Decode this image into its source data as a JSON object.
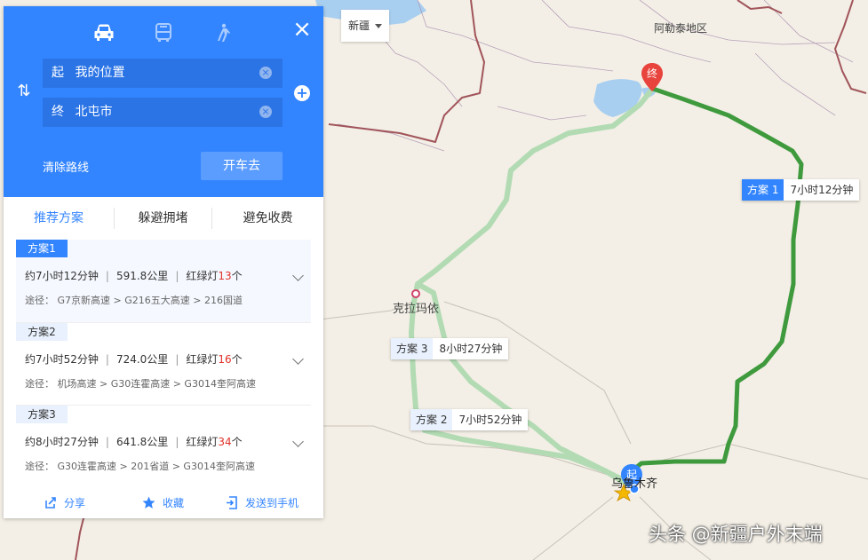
{
  "panel": {
    "modes": [
      "drive-icon",
      "bus-icon",
      "walk-icon"
    ],
    "origin": {
      "prefix": "起",
      "value": "我的位置"
    },
    "destination": {
      "prefix": "终",
      "value": "北屯市"
    },
    "clear_label": "清除路线",
    "go_label": "开车去",
    "tabs": [
      "推荐方案",
      "躲避拥堵",
      "避免收费"
    ],
    "plans": [
      {
        "tag": "方案1",
        "time": "约7小时12分钟",
        "distance": "591.8公里",
        "lights_label": "红绿灯",
        "lights": "13",
        "lights_unit": "个",
        "route": "途径： G7京新高速 > G216五大高速 > 216国道"
      },
      {
        "tag": "方案2",
        "time": "约7小时52分钟",
        "distance": "724.0公里",
        "lights_label": "红绿灯",
        "lights": "16",
        "lights_unit": "个",
        "route": "途径： 机场高速 > G30连霍高速 > G3014奎阿高速"
      },
      {
        "tag": "方案3",
        "time": "约8小时27分钟",
        "distance": "641.8公里",
        "lights_label": "红绿灯",
        "lights": "34",
        "lights_unit": "个",
        "route": "途径： G30连霍高速 > 201省道 > G3014奎阿高速"
      }
    ],
    "footer": {
      "share": "分享",
      "favorite": "收藏",
      "send": "发送到手机"
    }
  },
  "province_select": "新疆",
  "map": {
    "labels": {
      "altay": "阿勒泰地区",
      "karamay": "克拉玛依",
      "urumqi": "乌鲁木齐"
    },
    "markers": {
      "start": "起",
      "end": "终"
    },
    "route_labels": [
      {
        "tag": "方案 1",
        "time": "7小时12分钟"
      },
      {
        "tag": "方案 3",
        "time": "8小时27分钟"
      },
      {
        "tag": "方案 2",
        "time": "7小时52分钟"
      }
    ]
  },
  "watermark": "头条 @新疆户外末端",
  "colors": {
    "accent": "#3385ff",
    "route_main": "#3f9a3d",
    "route_alt": "#b2dbb3",
    "lights": "#e0322a"
  }
}
